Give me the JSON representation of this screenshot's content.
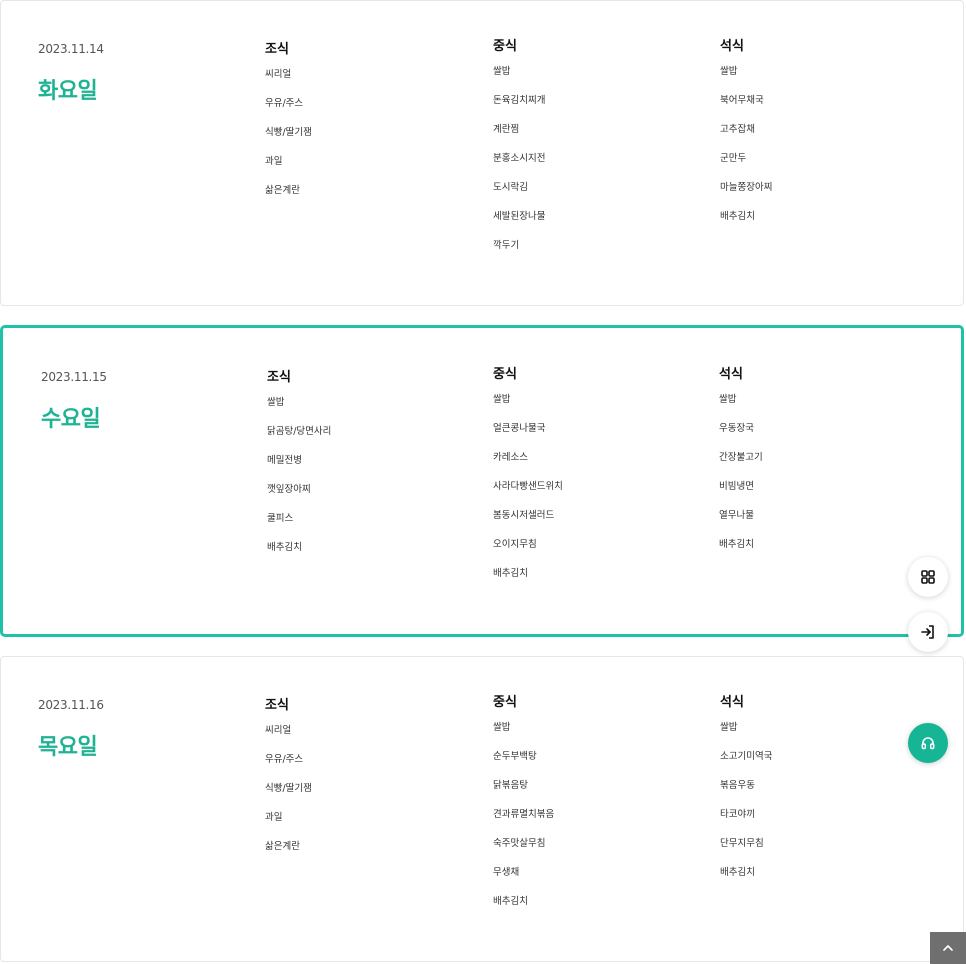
{
  "days": [
    {
      "date": "2023.11.14",
      "weekday": "화요일",
      "meals": [
        {
          "title": "조식",
          "items": [
            "씨리얼",
            "우유/주스",
            "식빵/딸기잼",
            "과일",
            "삶은계란"
          ]
        },
        {
          "title": "중식",
          "items": [
            "쌀밥",
            "돈육김치찌개",
            "계란찜",
            "분홍소시지전",
            "도시락김",
            "세발된장나물",
            "깍두기"
          ]
        },
        {
          "title": "석식",
          "items": [
            "쌀밥",
            "북어무채국",
            "고추잡채",
            "군만두",
            "마늘쫑장아찌",
            "배추김치"
          ]
        }
      ]
    },
    {
      "date": "2023.11.15",
      "weekday": "수요일",
      "meals": [
        {
          "title": "조식",
          "items": [
            "쌀밥",
            "닭곰탕/당면사리",
            "메밀전병",
            "깻잎장아찌",
            "쿨피스",
            "배추김치"
          ]
        },
        {
          "title": "중식",
          "items": [
            "쌀밥",
            "얼큰콩나물국",
            "카레소스",
            "사라다빵샌드위치",
            "봄동시저샐러드",
            "오이지무침",
            "배추김치"
          ]
        },
        {
          "title": "석식",
          "items": [
            "쌀밥",
            "우동장국",
            "간장불고기",
            "비빔냉면",
            "열무나물",
            "배추김치"
          ]
        }
      ]
    },
    {
      "date": "2023.11.16",
      "weekday": "목요일",
      "meals": [
        {
          "title": "조식",
          "items": [
            "씨리얼",
            "우유/주스",
            "식빵/딸기잼",
            "과일",
            "삶은계란"
          ]
        },
        {
          "title": "중식",
          "items": [
            "쌀밥",
            "순두부백탕",
            "닭볶음탕",
            "견과류멸치볶음",
            "숙주맛살무침",
            "무생채",
            "배추김치"
          ]
        },
        {
          "title": "석식",
          "items": [
            "쌀밥",
            "소고기미역국",
            "볶음우동",
            "타코야끼",
            "단무지무침",
            "배추김치"
          ]
        }
      ]
    }
  ],
  "floating": {
    "menu_icon": "grid-icon",
    "login_icon": "login-icon",
    "support_icon": "headset-icon",
    "top_icon": "chevron-up-icon"
  },
  "colors": {
    "accent": "#1fb394",
    "active_border": "#1fc1a8",
    "support_btn": "#16b596",
    "top_btn": "#6f6f6f"
  }
}
